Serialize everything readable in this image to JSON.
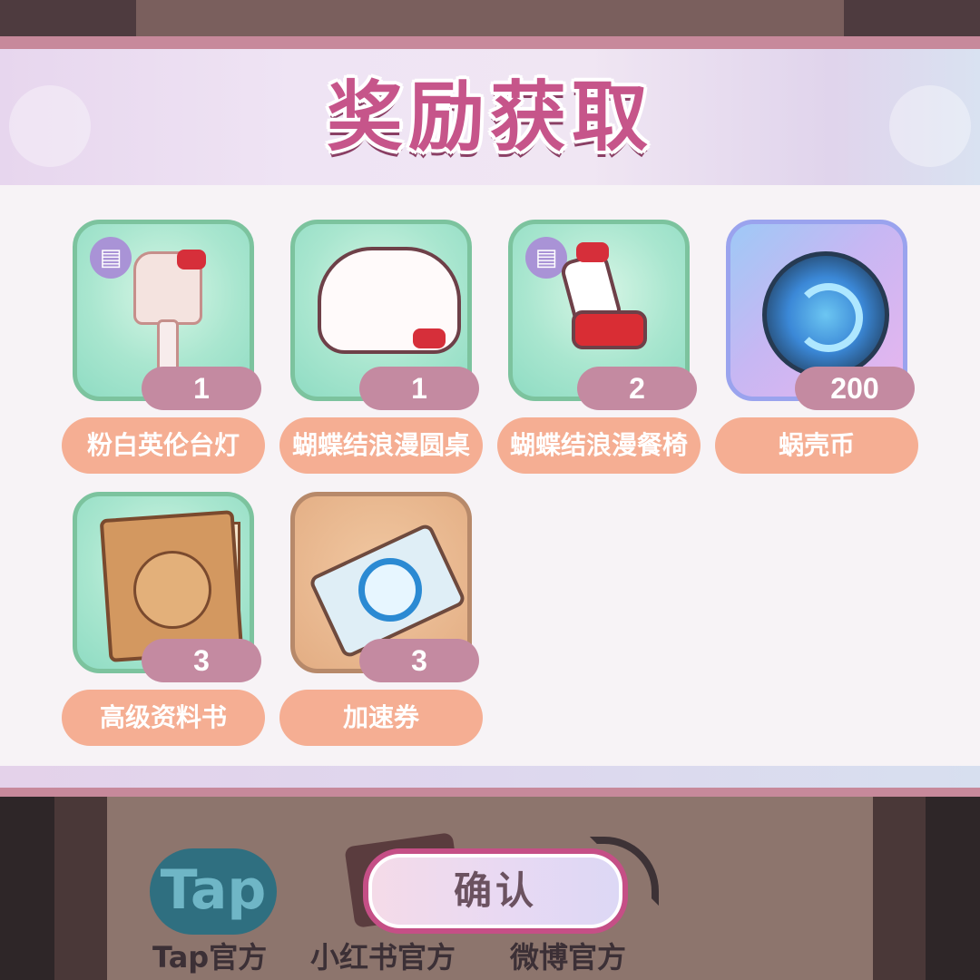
{
  "title": "奖励获取",
  "rewards": [
    {
      "name": "粉白英伦台灯",
      "count": "1",
      "icon": "lamp-icon",
      "tagged": true
    },
    {
      "name": "蝴蝶结浪漫圆桌",
      "count": "1",
      "icon": "round-table-icon",
      "tagged": false
    },
    {
      "name": "蝴蝶结浪漫餐椅",
      "count": "2",
      "icon": "chair-icon",
      "tagged": true
    },
    {
      "name": "蜗壳币",
      "count": "200",
      "icon": "snail-coin-icon",
      "tagged": false
    },
    {
      "name": "高级资料书",
      "count": "3",
      "icon": "book-icon",
      "tagged": false
    },
    {
      "name": "加速券",
      "count": "3",
      "icon": "ticket-icon",
      "tagged": false
    }
  ],
  "confirm_label": "确认",
  "background": {
    "tap_logo": "Tap",
    "social_links": [
      "Tap官方",
      "小红书官方",
      "微博官方"
    ]
  },
  "colors": {
    "title": "#c6558a",
    "name_pill": "#f5ae93",
    "count_pill": "#c48aa1",
    "modal_border": "#c7899b"
  }
}
